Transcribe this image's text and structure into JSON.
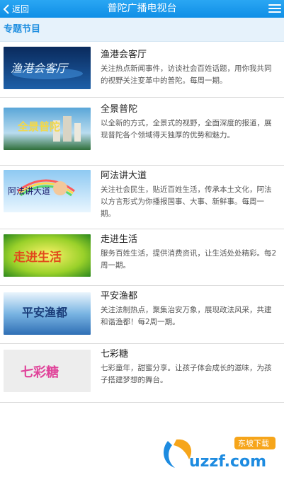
{
  "topbar": {
    "back_label": "返回",
    "title": "普陀广播电视台"
  },
  "section": {
    "title": "专题节目"
  },
  "programs": [
    {
      "name": "渔港会客厅",
      "desc": "关注热点新闻事件，访谈社会百姓话题，用你我共同的视野关注变革中的普陀。每周一期。",
      "thumb_text": "渔港会客厅"
    },
    {
      "name": "全景普陀",
      "desc": "以全新的方式，全景式的视野，全面深度的报道，展现普陀各个领域得天独厚的优势和魅力。",
      "thumb_text": "全景普陀"
    },
    {
      "name": "阿法讲大道",
      "desc": "关注社会民生，贴近百姓生活，传承本土文化，阿法以方言形式为你播报国事、大事、新鲜事。每周一期。",
      "thumb_text": "阿法讲大道"
    },
    {
      "name": "走进生活",
      "desc": "服务百姓生活，提供消费资讯，让生活处处精彩。每2周一期。",
      "thumb_text": "走进生活"
    },
    {
      "name": "平安渔都",
      "desc": "关注法制热点，聚集治安万象，展现政法风采，共建和谐渔都！每2周一期。",
      "thumb_text": "平安渔都"
    },
    {
      "name": "七彩糖",
      "desc": "七彩童年，甜蜜分享。让孩子体会成长的滋味，为孩子搭建梦想的舞台。",
      "thumb_text": "七彩糖"
    }
  ],
  "watermark": {
    "text": "uzzf.com",
    "badge": "东坡下载"
  },
  "colors": {
    "topbar": "#1e9ae9",
    "section_bg": "#e6f2fb",
    "section_text": "#1e8ee0"
  }
}
